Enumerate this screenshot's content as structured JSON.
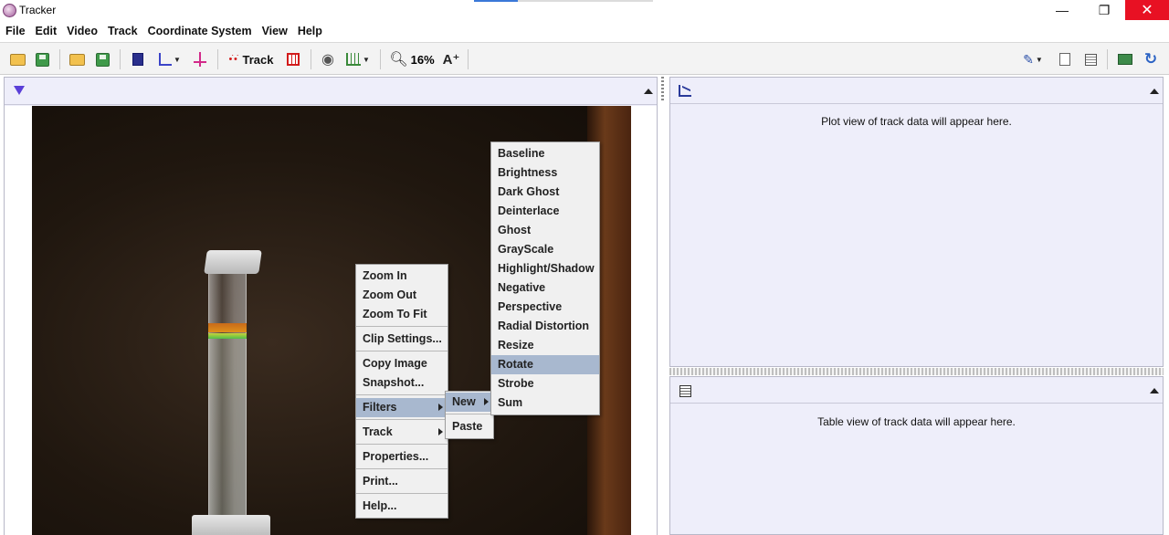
{
  "window": {
    "title": "Tracker",
    "minimize": "—",
    "maximize": "❐",
    "close": "✕"
  },
  "menubar": [
    "File",
    "Edit",
    "Video",
    "Track",
    "Coordinate System",
    "View",
    "Help"
  ],
  "toolbar": {
    "track_label": "Track",
    "zoom_level": "16%"
  },
  "plot_panel": {
    "message": "Plot view of track data will appear here."
  },
  "table_panel": {
    "message": "Table view of track data will appear here."
  },
  "context_menu": {
    "items": [
      "Zoom In",
      "Zoom Out",
      "Zoom To Fit",
      "Clip Settings...",
      "Copy Image",
      "Snapshot...",
      "Filters",
      "Track",
      "Properties...",
      "Print...",
      "Help..."
    ],
    "active": "Filters"
  },
  "filters_submenu": {
    "items": [
      "New",
      "Paste"
    ],
    "active": "New"
  },
  "new_filter_submenu": {
    "items": [
      "Baseline",
      "Brightness",
      "Dark Ghost",
      "Deinterlace",
      "Ghost",
      "GrayScale",
      "Highlight/Shadow",
      "Negative",
      "Perspective",
      "Radial Distortion",
      "Resize",
      "Rotate",
      "Strobe",
      "Sum"
    ],
    "active": "Rotate"
  },
  "colors": {
    "panel_bg": "#eeeefa",
    "menu_highlight": "#a8b8cf",
    "close_button": "#e81123"
  }
}
